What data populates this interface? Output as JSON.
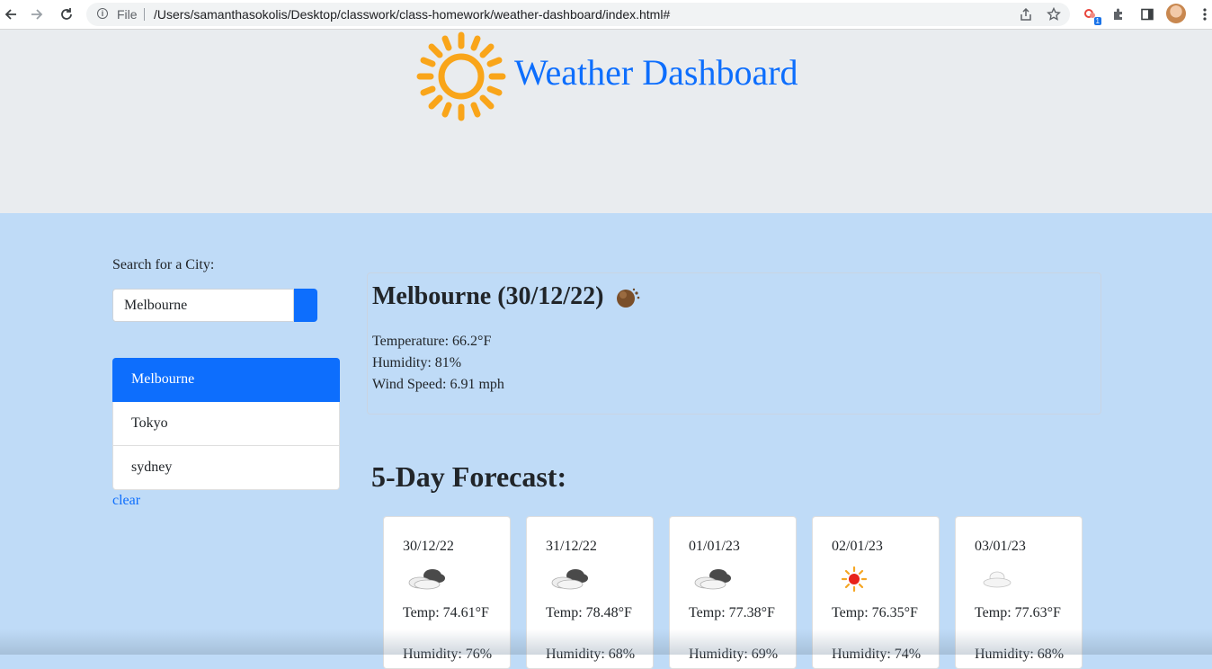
{
  "browser": {
    "scheme_label": "File",
    "url": "/Users/samanthasokolis/Desktop/classwork/class-homework/weather-dashboard/index.html#",
    "extension_badge": "1"
  },
  "header": {
    "title": "Weather Dashboard",
    "logo_icon": "sun-icon"
  },
  "sidebar": {
    "search_label": "Search for a City:",
    "search_value": "Melbourne",
    "history": [
      {
        "label": "Melbourne",
        "active": true
      },
      {
        "label": "Tokyo",
        "active": false
      },
      {
        "label": "sydney",
        "active": false
      }
    ],
    "clear_label": "clear"
  },
  "current": {
    "heading": "Melbourne (30/12/22)",
    "icon": "haze-icon",
    "temperature": "Temperature: 66.2°F",
    "humidity": "Humidity: 81%",
    "wind": "Wind Speed: 6.91 mph"
  },
  "forecast": {
    "title": "5-Day Forecast:",
    "days": [
      {
        "date": "30/12/22",
        "icon": "broken-clouds-icon",
        "temp": "Temp: 74.61°F",
        "humidity": "Humidity: 76%"
      },
      {
        "date": "31/12/22",
        "icon": "broken-clouds-icon",
        "temp": "Temp: 78.48°F",
        "humidity": "Humidity: 68%"
      },
      {
        "date": "01/01/23",
        "icon": "broken-clouds-icon",
        "temp": "Temp: 77.38°F",
        "humidity": "Humidity: 69%"
      },
      {
        "date": "02/01/23",
        "icon": "clear-sky-icon",
        "temp": "Temp: 76.35°F",
        "humidity": "Humidity: 74%"
      },
      {
        "date": "03/01/23",
        "icon": "few-clouds-icon",
        "temp": "Temp: 77.63°F",
        "humidity": "Humidity: 68%"
      }
    ]
  },
  "colors": {
    "primary": "#0d6efd",
    "header_bg": "#e9ecef",
    "page_bg": "#bfdbf7",
    "sun": "#f9a51a"
  }
}
